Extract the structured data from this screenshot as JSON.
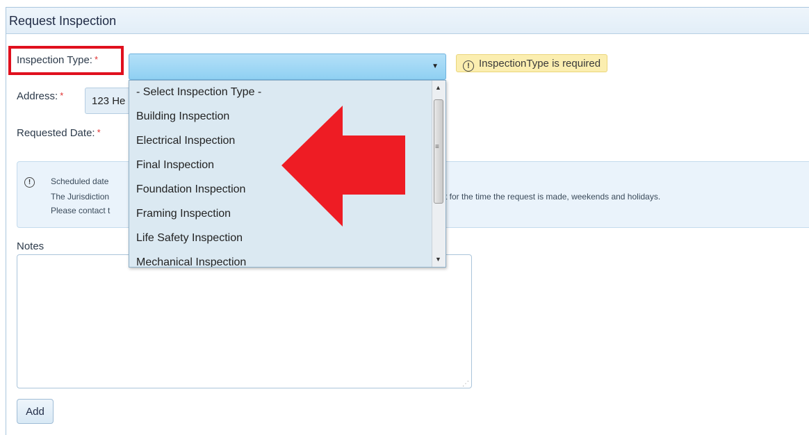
{
  "panel": {
    "title": "Request Inspection"
  },
  "form": {
    "inspection_type_label": "Inspection Type:",
    "address_label": "Address:",
    "requested_date_label": "Requested Date:",
    "required_marker": "*",
    "address_value": "123 He",
    "notes_label": "Notes",
    "notes_value": "",
    "add_label": "Add"
  },
  "validation": {
    "icon": "!",
    "message": "InspectionType is required"
  },
  "dropdown": {
    "selected": "",
    "options": [
      "- Select Inspection Type -",
      "Building Inspection",
      "Electrical Inspection",
      "Final Inspection",
      "Foundation Inspection",
      "Framing Inspection",
      "Life Safety Inspection",
      "Mechanical Inspection"
    ]
  },
  "info": {
    "icon": "!",
    "line1": "Scheduled date",
    "line2_start": "The Jurisdiction",
    "line2_end": "t for the time the request is made, weekends and holidays.",
    "line3": "Please contact t"
  },
  "icons": {
    "select_arrow": "▼",
    "scroll_up": "▲",
    "scroll_down": "▼",
    "grip": "≡",
    "resize": "⋰"
  },
  "colors": {
    "highlight_box": "#e0101e",
    "arrow": "#ee1c24",
    "select_bg": "#9fd6f4",
    "validation_bg": "#fbeeb0"
  }
}
